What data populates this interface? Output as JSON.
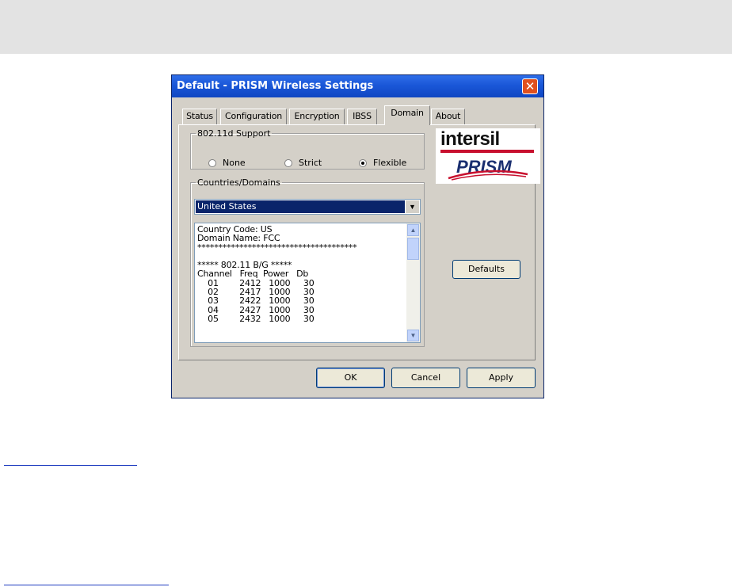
{
  "dialog": {
    "title": "Default - PRISM Wireless Settings",
    "close_glyph": "✕",
    "tabs": [
      {
        "label": "Status",
        "active": false
      },
      {
        "label": "Configuration",
        "active": false
      },
      {
        "label": "Encryption",
        "active": false
      },
      {
        "label": "IBSS",
        "active": false
      },
      {
        "label": "Domain",
        "active": true
      },
      {
        "label": "About",
        "active": false
      }
    ],
    "support_group": {
      "legend": "802.11d Support",
      "options": [
        {
          "label": "None",
          "checked": false
        },
        {
          "label": "Strict",
          "checked": false
        },
        {
          "label": "Flexible",
          "checked": true
        }
      ]
    },
    "countries_group": {
      "legend": "Countries/Domains",
      "selected": "United States",
      "arrow_icon": "▼",
      "details_lines": [
        "Country Code: US",
        "Domain Name: FCC",
        "**************************************",
        "",
        "***** 802.11 B/G *****",
        "Channel   Freq  Power   Db",
        "    01        2412   1000     30",
        "    02        2417   1000     30",
        "    03        2422   1000     30",
        "    04        2427   1000     30",
        "    05        2432   1000     30"
      ],
      "scroll_up_icon": "▲",
      "scroll_down_icon": "▼"
    },
    "logo": {
      "brand": "intersil",
      "product": "PRISM"
    },
    "buttons": {
      "defaults": "Defaults",
      "ok": "OK",
      "cancel": "Cancel",
      "apply": "Apply"
    },
    "colors": {
      "titlebar": "#1a57d8",
      "selection": "#0a246a",
      "dialog_face": "#d4d0c8",
      "brand_red": "#c8102e",
      "brand_navy": "#1a2f70"
    }
  }
}
